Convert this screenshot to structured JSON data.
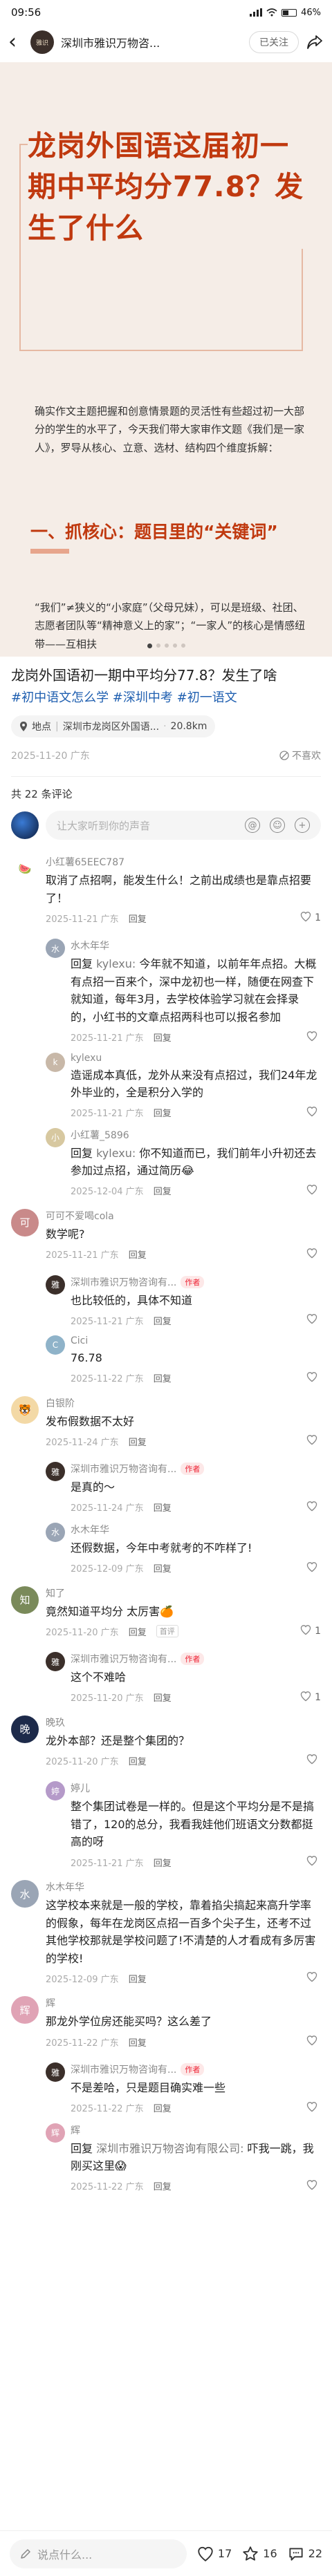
{
  "status": {
    "time": "09:56",
    "battery": "46%"
  },
  "nav": {
    "author": "深圳市雅识万物咨...",
    "avatar_text": "雅识",
    "follow": "已关注"
  },
  "cover": {
    "title": "龙岗外国语这届初一期中平均分77.8？发生了什么",
    "intro": "确实作文主题把握和创意情景题的灵活性有些超过初一大部分的学生的水平了，今天我们带大家审作文题《我们是一家人》，罗导从核心、立意、选材、结构四个维度拆解：",
    "section": "一、抓核心：题目里的“关键词”",
    "body": "“我们”≠狭义的“小家庭”（父母兄妹），可以是班级、社团、志愿者团队等“精神意义上的家”；“一家人”的核心是情感纽带——互相扶"
  },
  "post": {
    "title": "龙岗外国语初一期中平均分77.8？发生了啥",
    "tags": "#初中语文怎么学 #深圳中考 #初一语文",
    "location_label": "地点",
    "location": "深圳市龙岗区外国语...",
    "distance": "20.8km",
    "date": "2025-11-20 广东",
    "no_like": "不喜欢"
  },
  "comments_section": {
    "count": "共 22 条评论",
    "input_placeholder": "让大家听到你的声音",
    "at": "@",
    "emoji": "☺",
    "plus": "+"
  },
  "comments": [
    {
      "name": "小红薯65EEC787",
      "avatar": "🍉",
      "avatar_color": "#ffffff",
      "text": "取消了点招啊，能发生什么！之前出成绩也是靠点招要了！",
      "date": "2025-11-21 广东",
      "reply": "回复",
      "likes": "1",
      "replies": [
        {
          "name": "水木年华",
          "avatar": "水",
          "avatar_color": "#9aa5b5",
          "author": false,
          "reply_to": "回复 ",
          "reply_at": "kylexu:",
          "text": " 今年就不知道，以前年年点招。大概有点招一百来个，深中龙初也一样，随便在网查下就知道，每年3月，去学校体验学习就在会择录的，小红书的文章点招两科也可以报名参加",
          "date": "2025-11-21 广东",
          "reply": "回复",
          "likes": ""
        },
        {
          "name": "kylexu",
          "avatar": "k",
          "avatar_color": "#c8b8a8",
          "author": false,
          "reply_to": "",
          "reply_at": "",
          "text": "造谣成本真低，龙外从来没有点招过，我们24年龙外毕业的，全是积分入学的",
          "date": "2025-11-21 广东",
          "reply": "回复",
          "likes": ""
        },
        {
          "name": "小红薯_5896",
          "avatar": "小",
          "avatar_color": "#d7c8a0",
          "author": false,
          "reply_to": "回复 ",
          "reply_at": "kylexu:",
          "text": " 你不知道而已，我们前年小升初还去参加过点招，通过简历😂",
          "date": "2025-12-04 广东",
          "reply": "回复",
          "likes": ""
        }
      ],
      "expand": ""
    },
    {
      "name": "可可不爱喝cola",
      "avatar": "可",
      "avatar_color": "#c98a8a",
      "text": "数学呢?",
      "date": "2025-11-21 广东",
      "reply": "回复",
      "likes": "",
      "replies": [
        {
          "name": "深圳市雅识万物咨询有...",
          "avatar": "雅",
          "avatar_color": "#3b2f2a",
          "author": true,
          "reply_to": "",
          "reply_at": "",
          "text": "也比较低的，具体不知道",
          "date": "2025-11-21 广东",
          "reply": "回复",
          "likes": ""
        },
        {
          "name": "Cici",
          "avatar": "C",
          "avatar_color": "#8fb3c9",
          "author": false,
          "reply_to": "",
          "reply_at": "",
          "text": "76.78",
          "date": "2025-11-22 广东",
          "reply": "回复",
          "likes": ""
        }
      ],
      "expand": ""
    },
    {
      "name": "白银阶",
      "avatar": "🐯",
      "avatar_color": "#f3d9a6",
      "text": "发布假数据不太好",
      "date": "2025-11-24 广东",
      "reply": "回复",
      "likes": "",
      "replies": [
        {
          "name": "深圳市雅识万物咨询有...",
          "avatar": "雅",
          "avatar_color": "#3b2f2a",
          "author": true,
          "reply_to": "",
          "reply_at": "",
          "text": "是真的～",
          "date": "2025-11-24 广东",
          "reply": "回复",
          "likes": ""
        },
        {
          "name": "水木年华",
          "avatar": "水",
          "avatar_color": "#9aa5b5",
          "author": false,
          "reply_to": "",
          "reply_at": "",
          "text": "还假数据，今年中考就考的不咋样了!",
          "date": "2025-12-09 广东",
          "reply": "回复",
          "likes": ""
        }
      ],
      "expand": ""
    },
    {
      "name": "知了",
      "avatar": "知",
      "avatar_color": "#7a8a5a",
      "text": "竟然知道平均分 太厉害🍊",
      "date": "2025-11-20 广东",
      "reply": "回复",
      "likes": "1",
      "badge": "首评",
      "replies": [
        {
          "name": "深圳市雅识万物咨询有...",
          "avatar": "雅",
          "avatar_color": "#3b2f2a",
          "author": true,
          "reply_to": "",
          "reply_at": "",
          "text": "这个不难哈",
          "date": "2025-11-20 广东",
          "reply": "回复",
          "likes": "1"
        }
      ],
      "expand": ""
    },
    {
      "name": "晚玖",
      "avatar": "晚",
      "avatar_color": "#1d2a4a",
      "text": "龙外本部？还是整个集团的？",
      "date": "2025-11-20 广东",
      "reply": "回复",
      "likes": "",
      "replies": [
        {
          "name": "婷儿",
          "avatar": "婷",
          "avatar_color": "#b59ac9",
          "author": false,
          "reply_to": "",
          "reply_at": "",
          "text": "整个集团试卷是一样的。但是这个平均分是不是搞错了，120的总分，我看我娃他们班语文分数都挺高的呀",
          "date": "2025-11-21 广东",
          "reply": "回复",
          "likes": ""
        }
      ],
      "expand": ""
    },
    {
      "name": "水木年华",
      "avatar": "水",
      "avatar_color": "#9aa5b5",
      "text": "这学校本来就是一般的学校，靠着掐尖搞起来高升学率的假象，每年在龙岗区点招一百多个尖子生，还考不过其他学校那就是学校问题了!不清楚的人才看成有多厉害的学校!",
      "date": "2025-12-09 广东",
      "reply": "回复",
      "likes": "",
      "replies": [],
      "expand": ""
    },
    {
      "name": "辉",
      "avatar": "辉",
      "avatar_color": "#e0a3b5",
      "text": "那龙外学位房还能买吗？这么差了",
      "date": "2025-11-22 广东",
      "reply": "回复",
      "likes": "",
      "replies": [
        {
          "name": "深圳市雅识万物咨询有...",
          "avatar": "雅",
          "avatar_color": "#3b2f2a",
          "author": true,
          "reply_to": "",
          "reply_at": "",
          "text": "不是差哈，只是题目确实难一些",
          "date": "2025-11-22 广东",
          "reply": "回复",
          "likes": ""
        },
        {
          "name": "辉",
          "avatar": "辉",
          "avatar_color": "#e0a3b5",
          "author": false,
          "reply_to": "回复 ",
          "reply_at": "深圳市雅识万物咨询有限公司:",
          "text": " 吓我一跳，我刚买这里😱",
          "date": "2025-11-22 广东",
          "reply": "回复",
          "likes": ""
        }
      ],
      "expand": ""
    }
  ],
  "bottom": {
    "say": "说点什么...",
    "likes": "17",
    "stars": "16",
    "comments": "22"
  }
}
